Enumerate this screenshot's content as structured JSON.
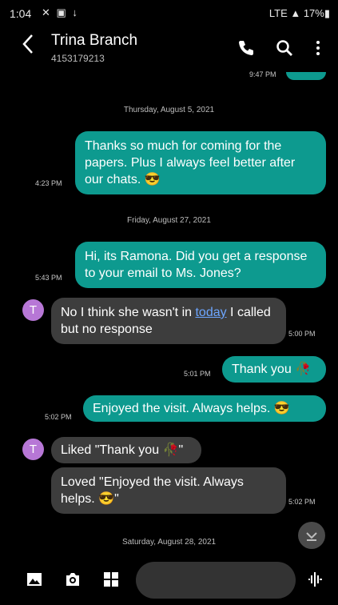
{
  "status_bar": {
    "time": "1:04",
    "notification_icons": "✕ ▣ ↓",
    "right": "LTE ▲ 17%▮"
  },
  "header": {
    "contact_name": "Trina Branch",
    "contact_number": "4153179213",
    "back_icon": "back-arrow-icon",
    "call_icon": "phone-icon",
    "search_icon": "search-icon",
    "more_icon": "more-vertical-icon"
  },
  "messages": {
    "top_cut_time": "9:47 PM",
    "date_1": "Thursday, August 5, 2021",
    "msg_1": {
      "text": "Thanks so much for coming for the papers.  Plus I always feel better after our chats. 😎",
      "time": "4:23 PM"
    },
    "date_2": "Friday, August 27, 2021",
    "msg_2": {
      "text": "Hi, its Ramona.  Did you get a response to your email to Ms. Jones?",
      "time": "5:43 PM"
    },
    "msg_3": {
      "avatar_letter": "T",
      "text_before": "No I think she wasn't in ",
      "link": "today",
      "text_after": " I called but no response",
      "time": "5:00 PM"
    },
    "msg_4": {
      "text": "Thank you 🥀",
      "time": "5:01 PM"
    },
    "msg_5": {
      "text": "Enjoyed the visit.  Always helps. 😎",
      "time": "5:02 PM"
    },
    "msg_6": {
      "avatar_letter": "T",
      "text": "Liked \"Thank you 🥀\""
    },
    "msg_7": {
      "text": "Loved \"Enjoyed the visit.  Always helps. 😎\"",
      "time": "5:02 PM"
    },
    "date_3": "Saturday, August 28, 2021"
  },
  "composer": {
    "gallery_icon": "image-icon",
    "camera_icon": "camera-icon",
    "apps_icon": "grid-icon",
    "input_placeholder": "",
    "voice_icon": "voice-wave-icon"
  },
  "colors": {
    "outgoing_bubble": "#0d9a8f",
    "incoming_bubble": "#3d3d3d",
    "avatar": "#b777d6",
    "link": "#6da6ff"
  }
}
